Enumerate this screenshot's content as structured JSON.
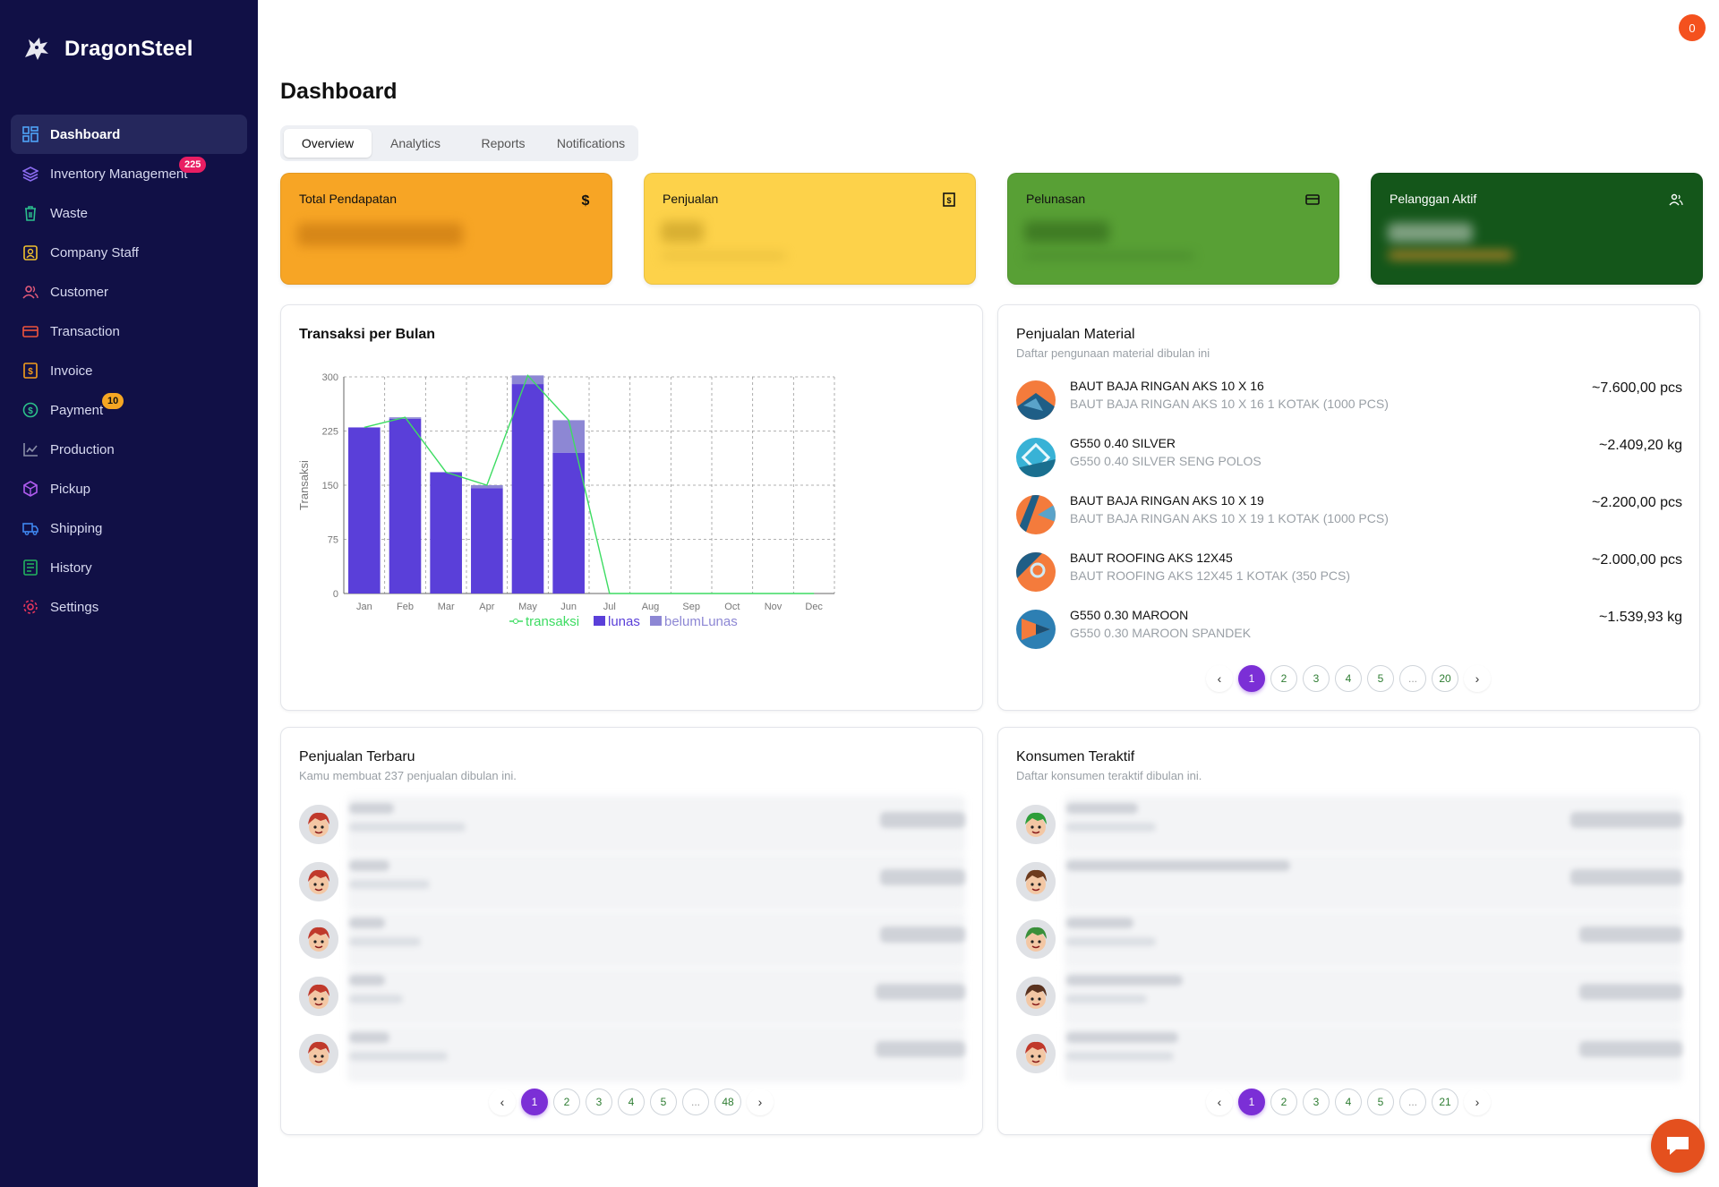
{
  "app": {
    "name": "DragonSteel",
    "notification_count": "0"
  },
  "sidebar": {
    "items": [
      {
        "label": "Dashboard",
        "icon": "dashboard-icon",
        "active": true
      },
      {
        "label": "Inventory Management",
        "icon": "layers-icon",
        "badge": "225"
      },
      {
        "label": "Waste",
        "icon": "trash-icon"
      },
      {
        "label": "Company Staff",
        "icon": "staff-icon"
      },
      {
        "label": "Customer",
        "icon": "users-icon"
      },
      {
        "label": "Transaction",
        "icon": "card-icon"
      },
      {
        "label": "Invoice",
        "icon": "invoice-icon"
      },
      {
        "label": "Payment",
        "icon": "dollar-circle-icon",
        "badge": "10"
      },
      {
        "label": "Production",
        "icon": "chart-icon"
      },
      {
        "label": "Pickup",
        "icon": "box-icon"
      },
      {
        "label": "Shipping",
        "icon": "truck-icon"
      },
      {
        "label": "History",
        "icon": "history-icon"
      },
      {
        "label": "Settings",
        "icon": "gear-icon"
      }
    ]
  },
  "page": {
    "title": "Dashboard"
  },
  "tabs": [
    "Overview",
    "Analytics",
    "Reports",
    "Notifications"
  ],
  "stats": [
    {
      "label": "Total Pendapatan",
      "icon": "dollar-icon",
      "color": "#f7a525"
    },
    {
      "label": "Penjualan",
      "icon": "receipt-icon",
      "color": "#fdd24a"
    },
    {
      "label": "Pelunasan",
      "icon": "credit-card-icon",
      "color": "#58a035"
    },
    {
      "label": "Pelanggan Aktif",
      "icon": "users-icon",
      "color": "#14561a"
    }
  ],
  "transaksi_panel": {
    "title": "Transaksi per Bulan"
  },
  "chart_data": {
    "type": "bar",
    "categories": [
      "Jan",
      "Feb",
      "Mar",
      "Apr",
      "May",
      "Jun",
      "Jul",
      "Aug",
      "Sep",
      "Oct",
      "Nov",
      "Dec"
    ],
    "series": [
      {
        "name": "transaksi",
        "kind": "line",
        "color": "#3ddc62",
        "values": [
          230,
          244,
          168,
          150,
          302,
          240,
          0,
          0,
          0,
          0,
          0,
          0
        ]
      },
      {
        "name": "lunas",
        "kind": "bar-stacked",
        "color": "#5a3fd9",
        "values": [
          230,
          242,
          168,
          146,
          290,
          195,
          0,
          0,
          0,
          0,
          0,
          0
        ]
      },
      {
        "name": "belumLunas",
        "kind": "bar-stacked",
        "color": "#8d87d4",
        "values": [
          0,
          2,
          0,
          4,
          12,
          45,
          0,
          0,
          0,
          0,
          0,
          0
        ]
      }
    ],
    "yticks": [
      0,
      75,
      150,
      225,
      300
    ],
    "ylim": [
      0,
      300
    ],
    "ylabel": "Transaksi",
    "xlabel": "",
    "grid": true,
    "legend_position": "bottom"
  },
  "material_panel": {
    "title": "Penjualan Material",
    "subtitle": "Daftar pengunaan material dibulan ini",
    "items": [
      {
        "name": "BAUT BAJA RINGAN AKS 10 X 16",
        "desc": "BAUT BAJA RINGAN AKS 10 X 16 1 KOTAK (1000 PCS)",
        "qty": "~7.600,00 pcs",
        "colors": [
          "#f47b3c",
          "#1f5e86"
        ]
      },
      {
        "name": "G550 0.40 SILVER",
        "desc": "G550 0.40 SILVER SENG POLOS",
        "qty": "~2.409,20 kg",
        "colors": [
          "#38b2d6",
          "#c9ecf5"
        ]
      },
      {
        "name": "BAUT BAJA RINGAN AKS 10 X 19",
        "desc": "BAUT BAJA RINGAN AKS 10 X 19 1 KOTAK (1000 PCS)",
        "qty": "~2.200,00 pcs",
        "colors": [
          "#f47b3c",
          "#1f5e86"
        ]
      },
      {
        "name": "BAUT ROOFING AKS 12X45",
        "desc": "BAUT ROOFING AKS 12X45 1 KOTAK (350 PCS)",
        "qty": "~2.000,00 pcs",
        "colors": [
          "#f47b3c",
          "#1f5e86"
        ]
      },
      {
        "name": "G550 0.30 MAROON",
        "desc": "G550 0.30 MAROON SPANDEK",
        "qty": "~1.539,93 kg",
        "colors": [
          "#f47b3c",
          "#2d7fb3"
        ]
      }
    ],
    "pages": [
      "1",
      "2",
      "3",
      "4",
      "5",
      "...",
      "20"
    ]
  },
  "recent_panel": {
    "title": "Penjualan Terbaru",
    "subtitle": "Kamu membuat 237 penjualan dibulan ini.",
    "pages": [
      "1",
      "2",
      "3",
      "4",
      "5",
      "...",
      "48"
    ]
  },
  "konsumen_panel": {
    "title": "Konsumen Teraktif",
    "subtitle": "Daftar konsumen teraktif dibulan ini.",
    "pages": [
      "1",
      "2",
      "3",
      "4",
      "5",
      "...",
      "21"
    ]
  }
}
